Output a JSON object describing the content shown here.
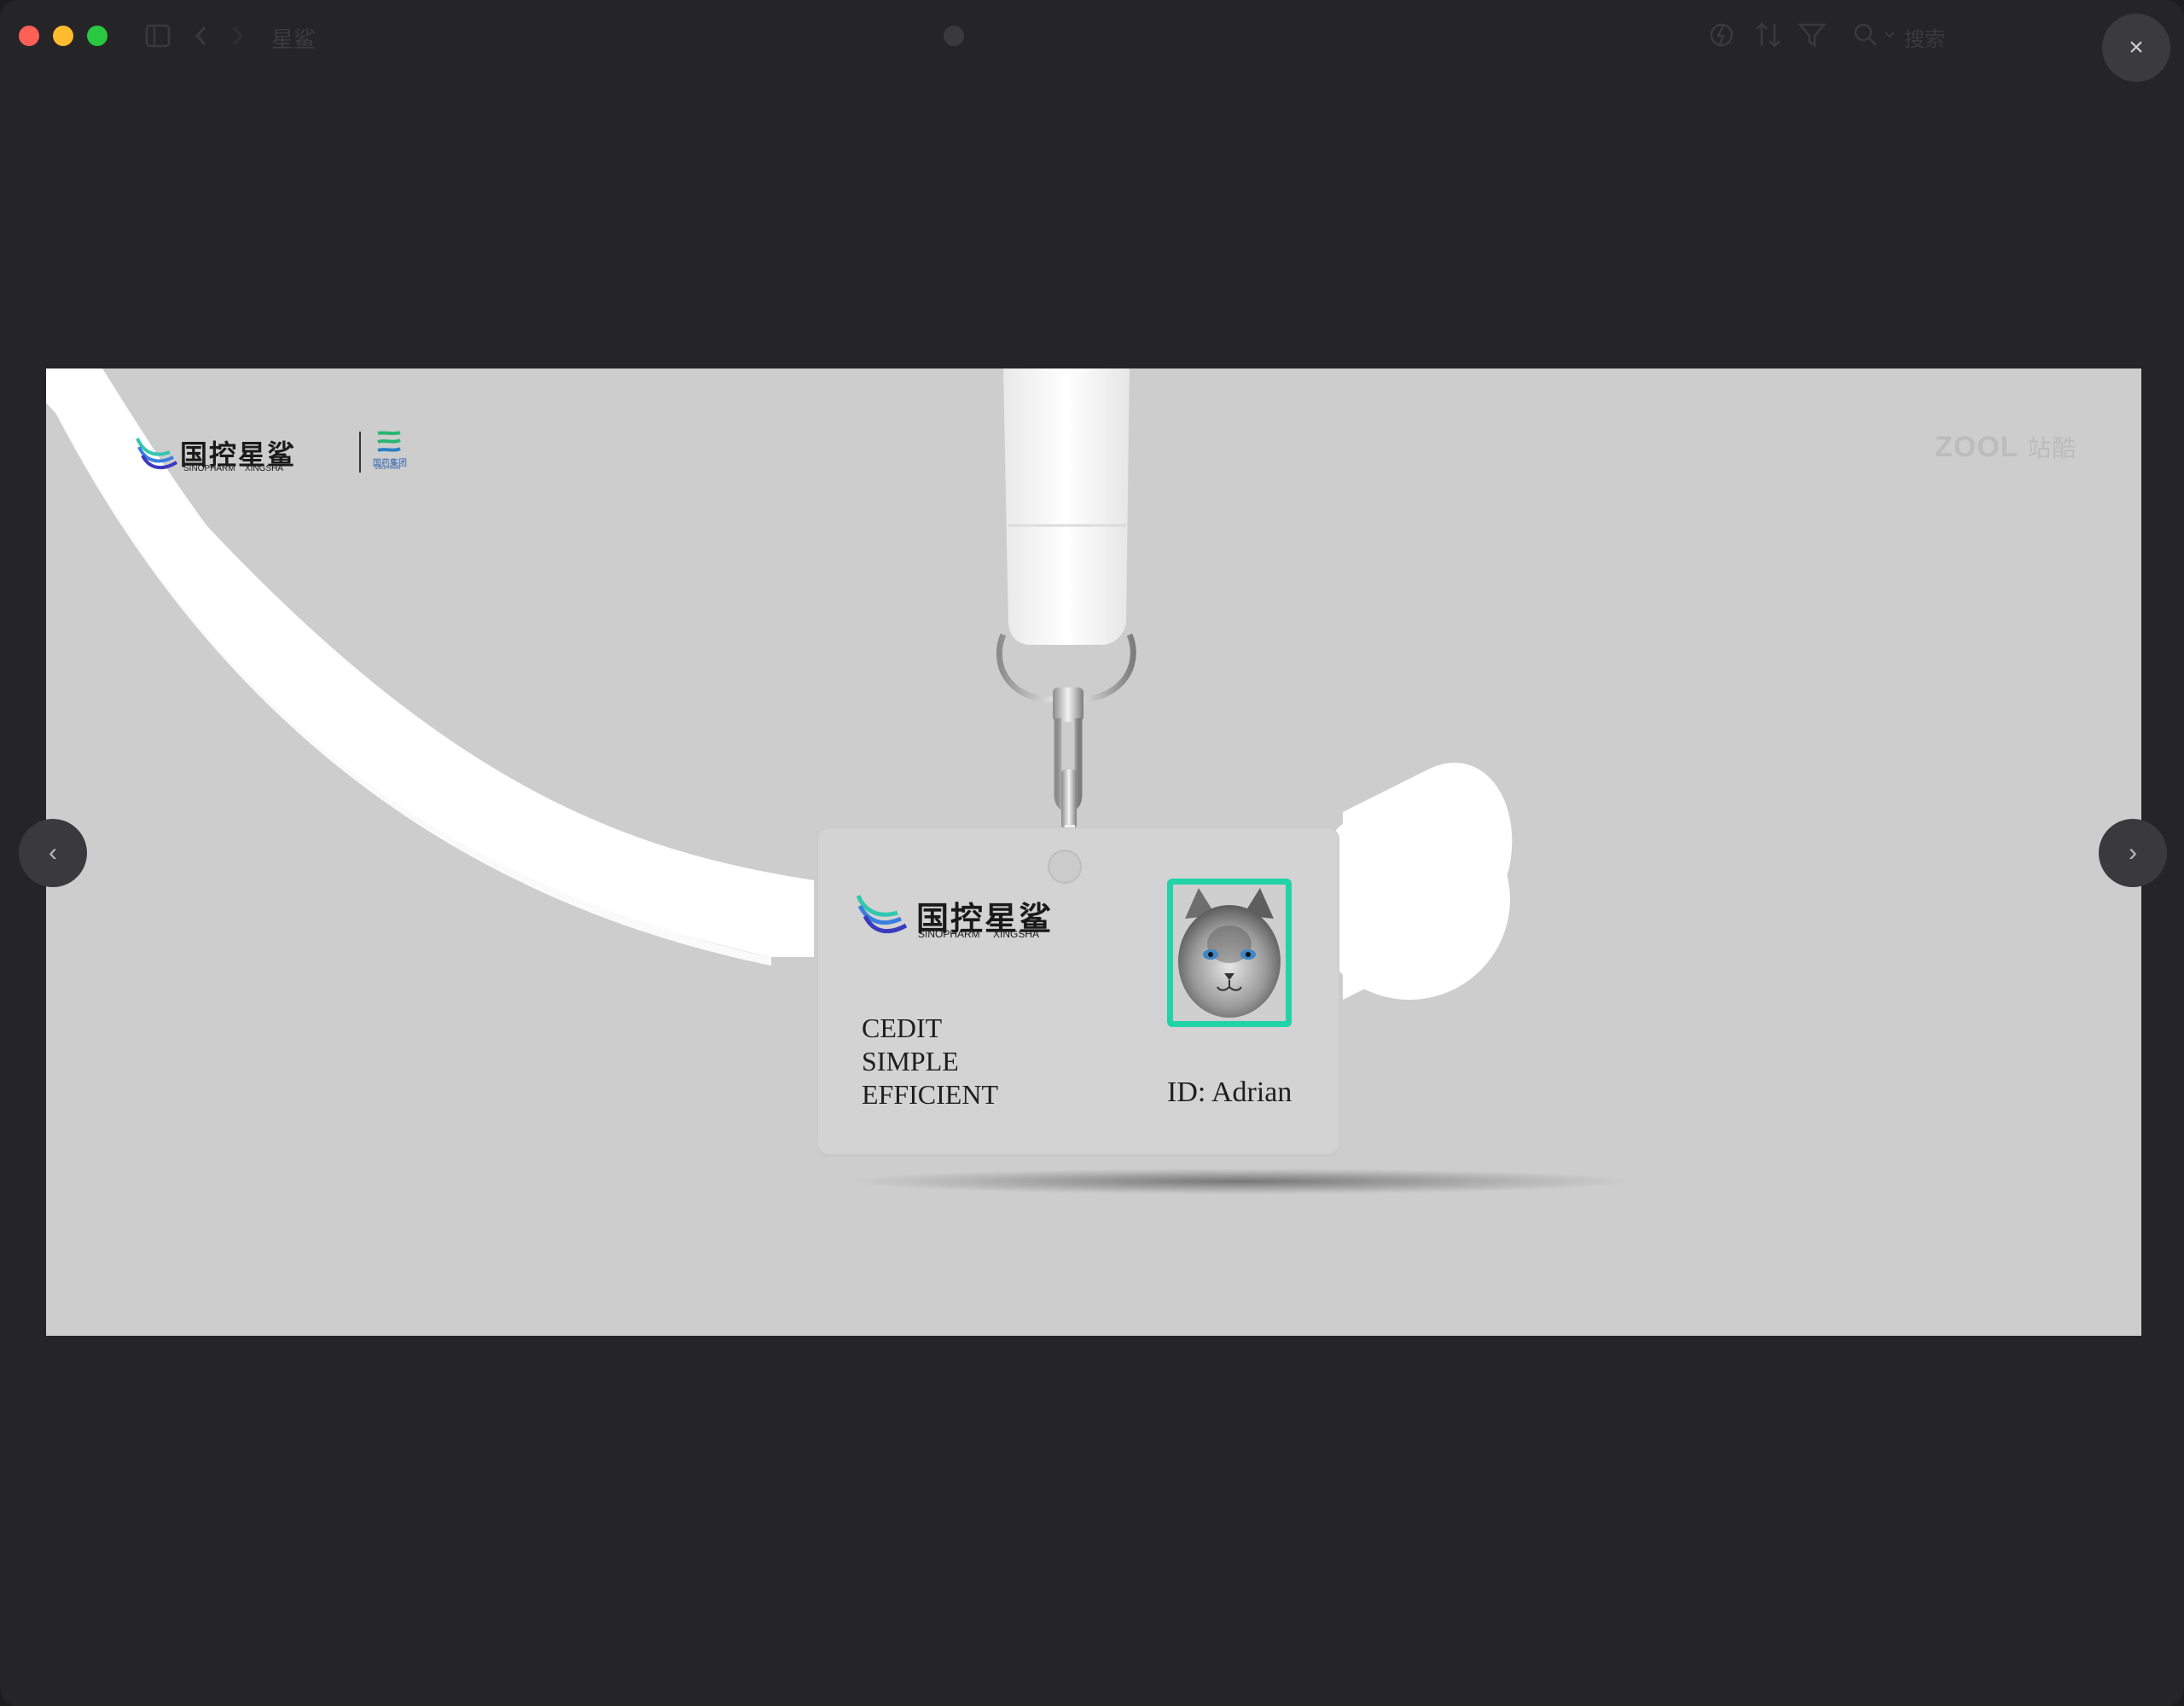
{
  "window": {
    "title": "星鲨",
    "search_label": "搜索",
    "close_glyph": "×",
    "prev_glyph": "‹",
    "next_glyph": "›"
  },
  "image": {
    "header_logo": {
      "chinese": "国控星鲨",
      "english_left": "SINOPHARM",
      "english_right": "XINGSHA"
    },
    "partner_logo": {
      "chinese": "国药集团",
      "english": "SINOPHARM"
    },
    "watermark": {
      "latin": "ZOOL",
      "chinese": "站酷"
    },
    "badge": {
      "logo": {
        "chinese": "国控星鲨",
        "english_left": "SINOPHARM",
        "english_right": "XINGSHA"
      },
      "lines": [
        "CEDIT",
        "SIMPLE",
        "EFFICIENT"
      ],
      "id_text": "ID: Adrian",
      "photo_icon": "cat-photo"
    }
  },
  "colors": {
    "window_bg": "#252528",
    "stage_bg": "#cdcdcd",
    "photo_frame": "#22d3a8",
    "traffic_red": "#fe5f57",
    "traffic_yellow": "#febc2e",
    "traffic_green": "#28c840"
  }
}
